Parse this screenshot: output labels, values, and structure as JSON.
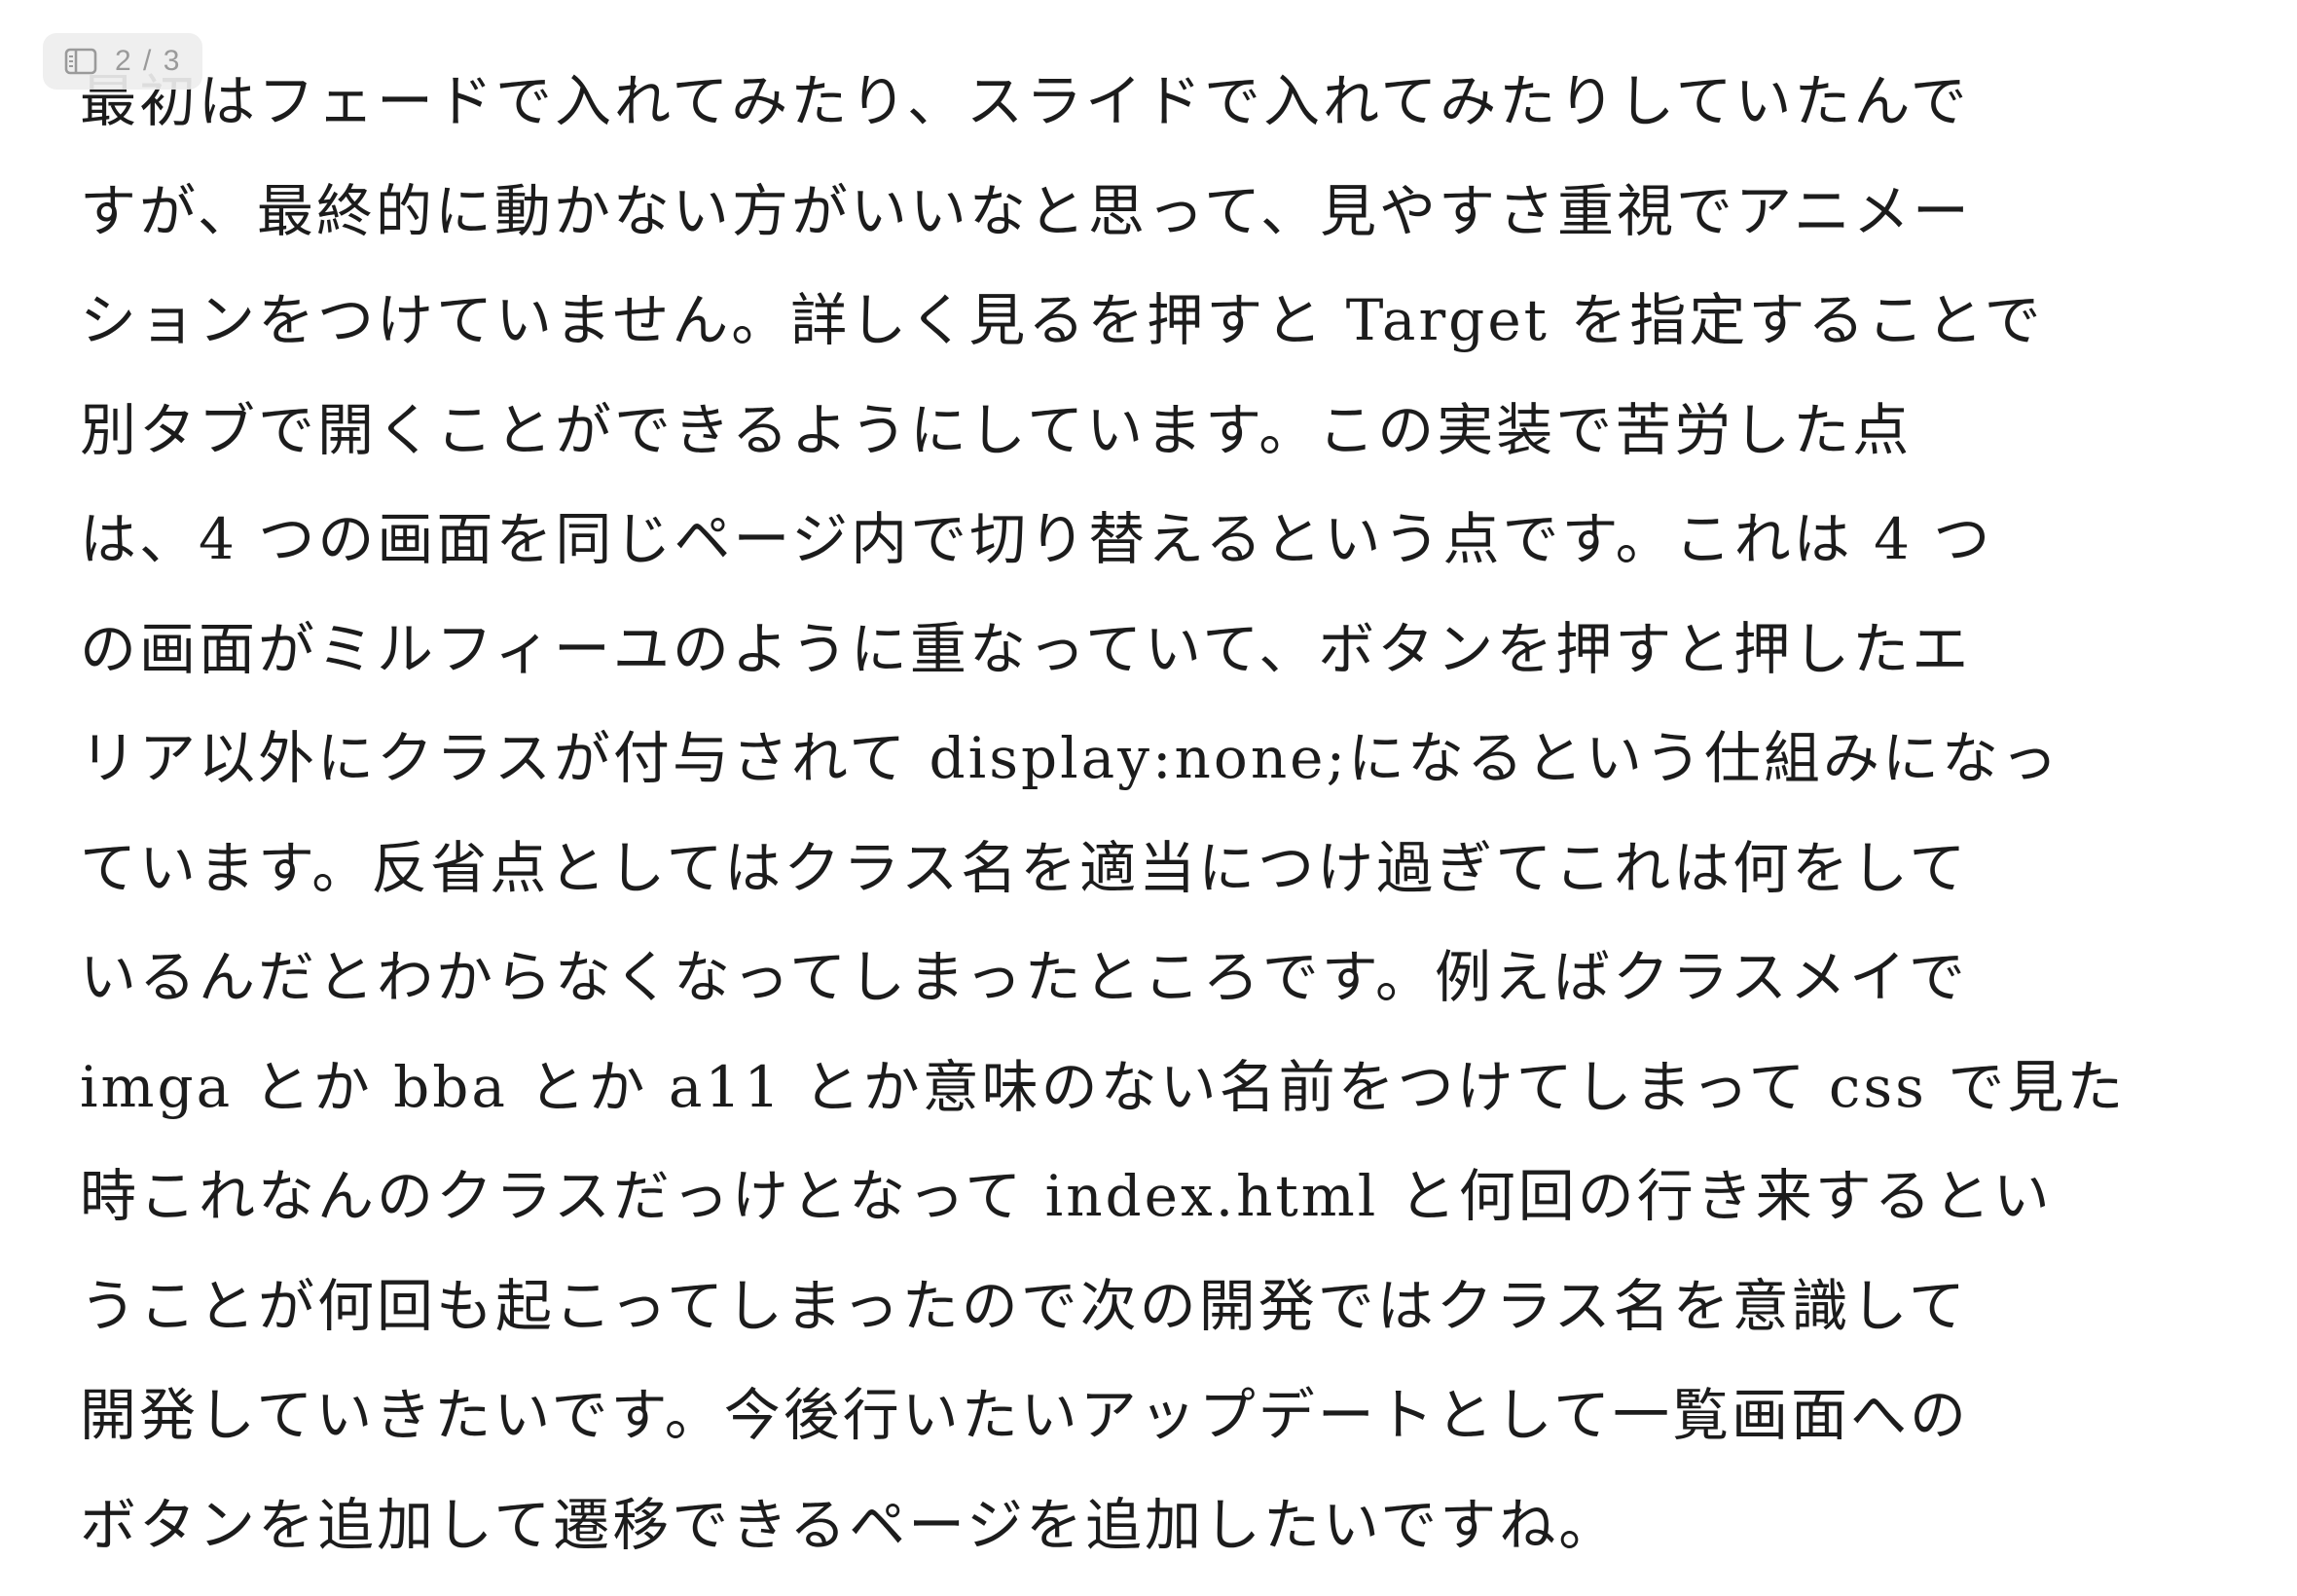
{
  "page_indicator": {
    "icon": "sidebar-panel-icon",
    "text": "2 / 3"
  },
  "article": {
    "lines": [
      "最初はフェードで入れてみたり、スライドで入れてみたりしていたんで",
      "すが、最終的に動かない方がいいなと思って、見やすさ重視でアニメー",
      "ションをつけていません。詳しく見るを押すと Target を指定することで",
      "別タブで開くことができるようにしています。この実装で苦労した点",
      "は、4 つの画面を同じページ内で切り替えるという点です。これは 4 つ",
      "の画面がミルフィーユのように重なっていて、ボタンを押すと押したエ",
      "リア以外にクラスが付与されて display:none;になるという仕組みになっ",
      "ています。反省点としてはクラス名を適当につけ過ぎてこれは何をして",
      "いるんだとわからなくなってしまったところです。例えばクラスメイで",
      "imga とか bba とか a11 とか意味のない名前をつけてしまって css で見た",
      "時これなんのクラスだっけとなって index.html と何回の行き来するとい",
      "うことが何回も起こってしまったので次の開発ではクラス名を意識して",
      "開発していきたいです。今後行いたいアップデートとして一覧画面への",
      "ボタンを追加して遷移できるページを追加したいですね。"
    ]
  }
}
